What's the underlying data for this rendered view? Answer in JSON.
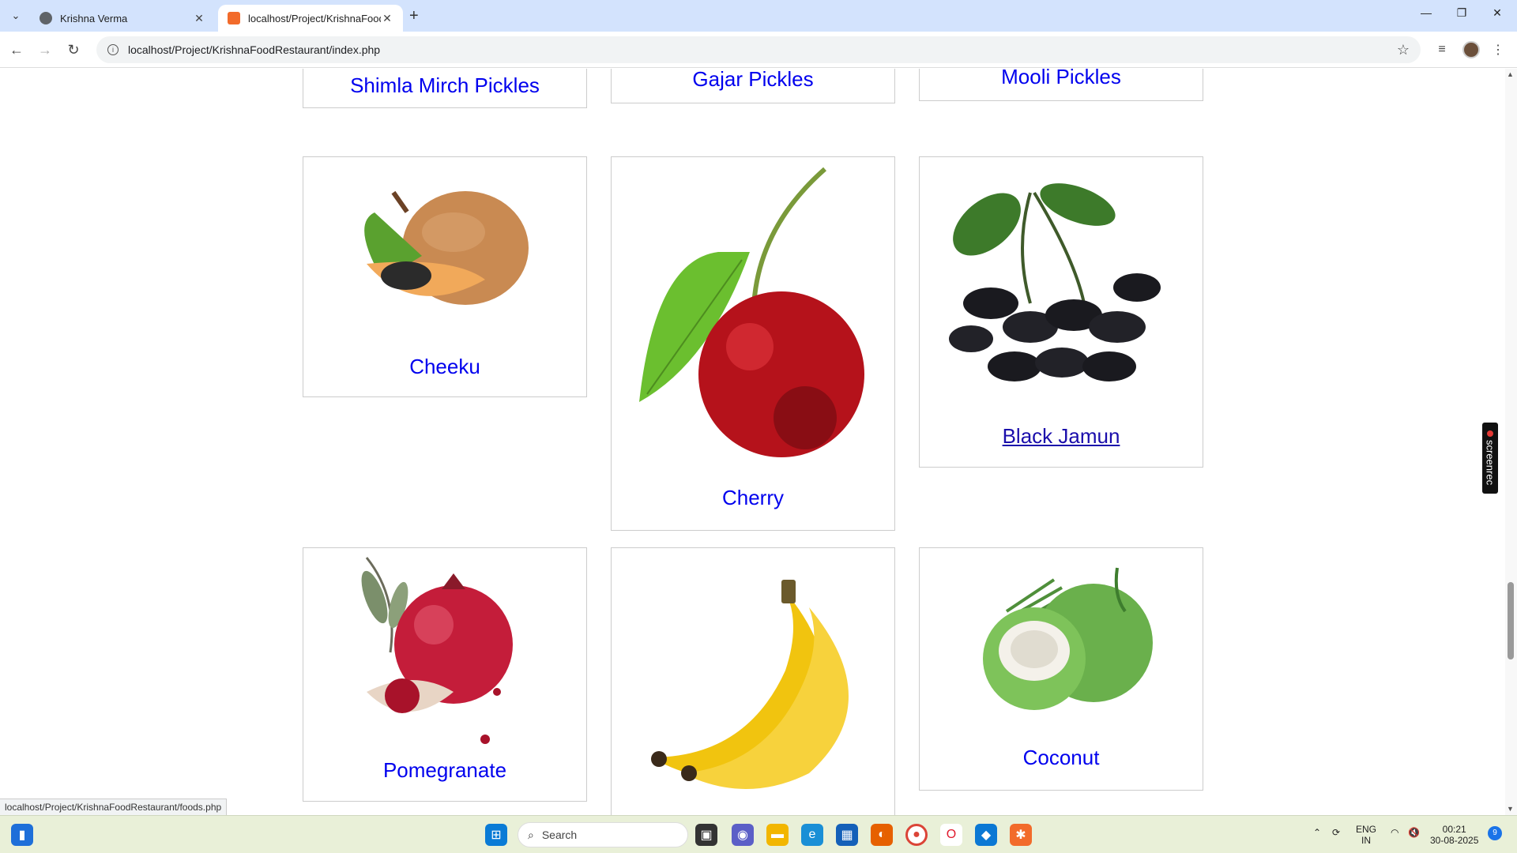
{
  "browser": {
    "tabs": [
      {
        "label": "Krishna Verma",
        "active": false
      },
      {
        "label": "localhost/Project/KrishnaFoodR",
        "active": true
      }
    ],
    "url": "localhost/Project/KrishnaFoodRestaurant/index.php",
    "status_url": "localhost/Project/KrishnaFoodRestaurant/foods.php"
  },
  "top_row": [
    "Shimla Mirch Pickles",
    "Gajar Pickles",
    "Mooli Pickles"
  ],
  "row1": [
    "Cheeku",
    "Cherry",
    "Black Jamun"
  ],
  "row2": [
    "Pomegranate",
    "",
    "Coconut"
  ],
  "screenrec_label": "screenrec",
  "taskbar": {
    "search_placeholder": "Search",
    "lang": "ENG",
    "region": "IN",
    "time": "00:21",
    "date": "30-08-2025",
    "notification_count": "9"
  }
}
